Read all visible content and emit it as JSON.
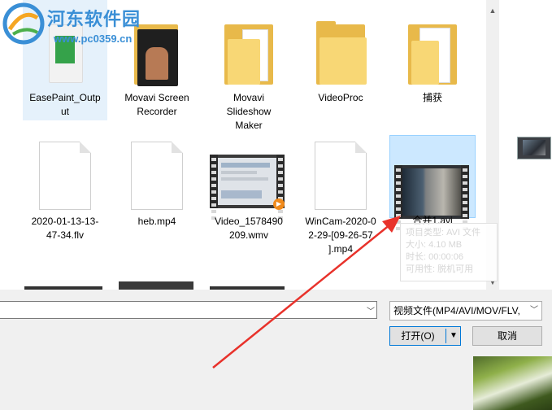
{
  "watermark": {
    "title": "河东软件园",
    "url": "www.pc0359.cn"
  },
  "files_row1": [
    {
      "label": "EasePaint_Output",
      "label_lines": [
        "EasePaint_Outp",
        "ut"
      ],
      "kind": "folder-media"
    },
    {
      "label": "Movavi Screen Recorder",
      "label_lines": [
        "Movavi Screen",
        "Recorder"
      ],
      "kind": "folder-photo"
    },
    {
      "label": "Movavi Slideshow Maker",
      "label_lines": [
        "Movavi",
        "Slideshow",
        "Maker"
      ],
      "kind": "folder-doc"
    },
    {
      "label": "VideoProc",
      "label_lines": [
        "VideoProc"
      ],
      "kind": "folder"
    },
    {
      "label": "捕获",
      "label_lines": [
        "捕获"
      ],
      "kind": "folder-doc"
    }
  ],
  "files_row2": [
    {
      "label": "2020-01-13-13-47-34.flv",
      "label_lines": [
        "2020-01-13-13-",
        "47-34.flv"
      ],
      "kind": "doc"
    },
    {
      "label": "heb.mp4",
      "label_lines": [
        "heb.mp4"
      ],
      "kind": "doc"
    },
    {
      "label": "Video_1578490209.wmv",
      "label_lines": [
        "Video_1578490",
        "209.wmv"
      ],
      "kind": "video"
    },
    {
      "label": "WinCam-2020-02-29-[09-26-57].mp4",
      "label_lines": [
        "WinCam-2020-0",
        "2-29-[09-26-57",
        "].mp4"
      ],
      "kind": "doc"
    },
    {
      "label": "合并1.avi",
      "label_lines": [
        "合并1.avi"
      ],
      "kind": "video-selected"
    }
  ],
  "tooltip": {
    "line1": "项目类型: AVI 文件",
    "line2": "大小: 4.10 MB",
    "line3": "时长: 00:00:06",
    "line4": "可用性: 脱机可用"
  },
  "bottom": {
    "filename_value": "",
    "filetype_value": "视频文件(MP4/AVI/MOV/FLV,",
    "open_label": "打开(O)",
    "cancel_label": "取消"
  },
  "colors": {
    "selection": "#cce8ff",
    "selection_border": "#99d1ff",
    "accent": "#0078d7",
    "annotation_arrow": "#e8322b"
  }
}
